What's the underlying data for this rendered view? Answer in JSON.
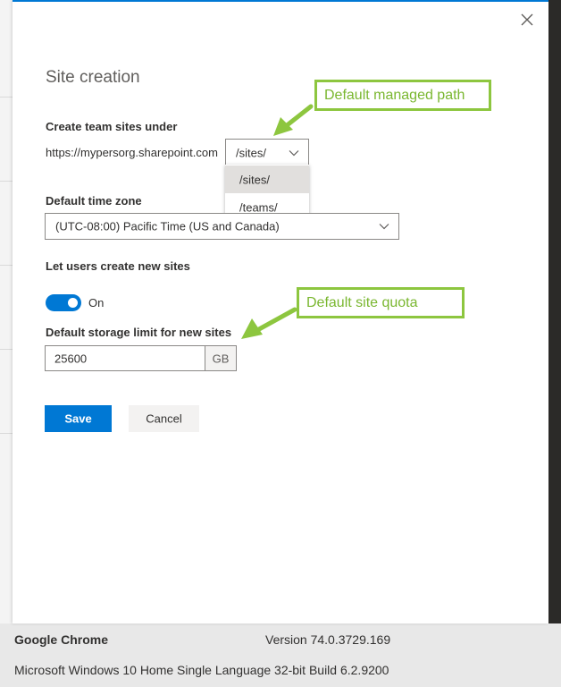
{
  "panel": {
    "title": "Site creation",
    "team_sites_label": "Create team sites under",
    "base_url": "https://mypersorg.sharepoint.com",
    "path_select_value": "/sites/",
    "path_options": [
      "/sites/",
      "/teams/"
    ],
    "timezone_label": "Default time zone",
    "timezone_value": "(UTC-08:00) Pacific Time (US and Canada)",
    "users_create_label": "Let users create new sites",
    "toggle_state_label": "On",
    "storage_label": "Default storage limit for new sites",
    "storage_value": "25600",
    "storage_unit": "GB",
    "save_label": "Save",
    "cancel_label": "Cancel"
  },
  "callouts": {
    "managed_path": "Default managed path",
    "site_quota": "Default site quota"
  },
  "footer": {
    "browser_name": "Google Chrome",
    "browser_version": "Version 74.0.3729.169",
    "os_info": "Microsoft Windows 10 Home Single Language 32-bit Build 6.2.9200"
  },
  "colors": {
    "accent": "#0078d4",
    "callout_green": "#8dc63f"
  },
  "icons": {
    "close": "close-icon",
    "chevron": "chevron-down-icon",
    "arrow": "callout-arrow-icon"
  }
}
